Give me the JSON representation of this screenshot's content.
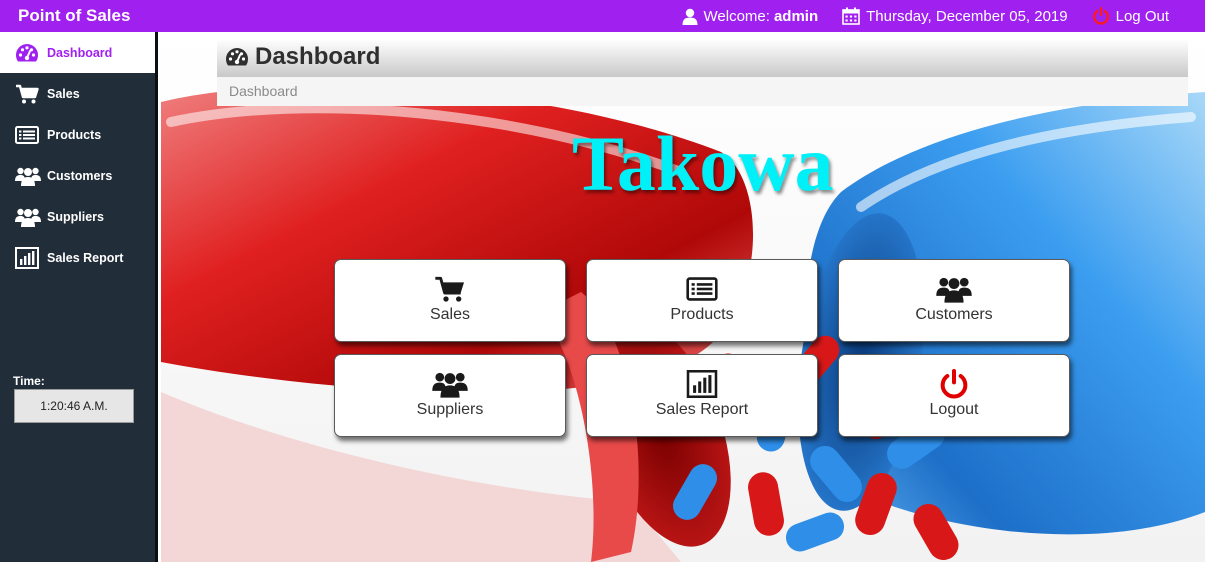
{
  "app": {
    "brand": "Point of Sales",
    "welcome_prefix": "Welcome:",
    "user": "admin",
    "date": "Thursday, December 05, 2019",
    "logout": "Log Out"
  },
  "sidebar": {
    "items": [
      {
        "label": "Dashboard",
        "icon": "dashboard-icon",
        "active": true
      },
      {
        "label": "Sales",
        "icon": "cart-icon"
      },
      {
        "label": "Products",
        "icon": "list-icon"
      },
      {
        "label": "Customers",
        "icon": "users-icon"
      },
      {
        "label": "Suppliers",
        "icon": "users-icon"
      },
      {
        "label": "Sales Report",
        "icon": "bar-chart-icon"
      }
    ],
    "time_label": "Time:",
    "time_value": "1:20:46 A.M."
  },
  "main": {
    "title": "Dashboard",
    "breadcrumb": "Dashboard",
    "hero_text": "Takowa",
    "tiles": [
      {
        "label": "Sales",
        "icon": "cart-icon"
      },
      {
        "label": "Products",
        "icon": "list-icon"
      },
      {
        "label": "Customers",
        "icon": "users-icon"
      },
      {
        "label": "Suppliers",
        "icon": "users-icon"
      },
      {
        "label": "Sales Report",
        "icon": "bar-chart-icon"
      },
      {
        "label": "Logout",
        "icon": "power-icon"
      }
    ]
  },
  "colors": {
    "topbar": "#a020f0",
    "sidebar": "#222d3a",
    "hero_text": "#00f0f8",
    "logout_icon": "#e00000"
  }
}
